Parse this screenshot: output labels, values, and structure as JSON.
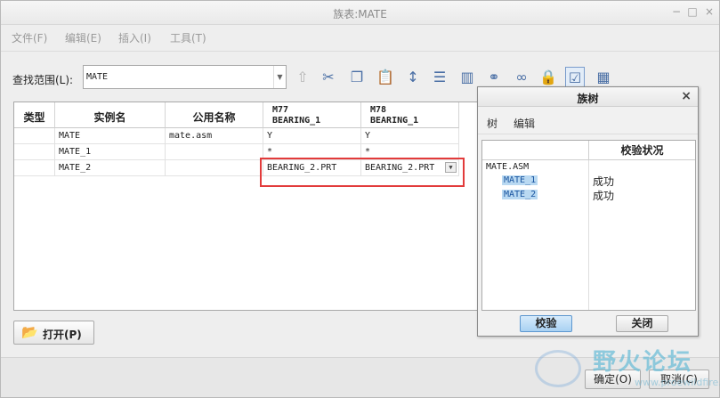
{
  "window": {
    "title": "族表:MATE",
    "minimize": "−",
    "maximize": "□",
    "close": "×"
  },
  "menu": [
    "文件(F)",
    "编辑(E)",
    "插入(I)",
    "工具(T)"
  ],
  "find": {
    "label": "查找范围(L):",
    "value": "MATE"
  },
  "toolbar_icons": [
    "up-level-icon",
    "cut-icon",
    "copy-icon",
    "paste-icon",
    "sort-icon",
    "insert-row-icon",
    "insert-column-icon",
    "binoculars-icon",
    "glasses-icon",
    "lock-icon",
    "verify-instances-icon",
    "table-icon"
  ],
  "table": {
    "headers": {
      "type": "类型",
      "instance": "实例名",
      "common": "公用名称",
      "col1": {
        "line1": "M77",
        "line2": "BEARING_1"
      },
      "col2": {
        "line1": "M78",
        "line2": "BEARING_1"
      }
    },
    "rows": [
      {
        "type": "",
        "instance": "MATE",
        "common": "mate.asm",
        "col1": "Y",
        "col2": "Y"
      },
      {
        "type": "",
        "instance": "MATE_1",
        "common": "",
        "col1": "*",
        "col2": "*"
      },
      {
        "type": "",
        "instance": "MATE_2",
        "common": "",
        "col1": "BEARING_2.PRT",
        "col2": "BEARING_2.PRT"
      }
    ]
  },
  "buttons": {
    "open": "打开(P)",
    "ok": "确定(O)",
    "cancel": "取消(C)"
  },
  "family_tree": {
    "title": "族树",
    "menu": [
      "树",
      "编辑"
    ],
    "column_header": "校验状况",
    "root": "MATE.ASM",
    "items": [
      {
        "name": "MATE_1",
        "status": "成功"
      },
      {
        "name": "MATE_2",
        "status": "成功"
      }
    ],
    "verify_button": "校验",
    "close_button": "关闭"
  },
  "watermark": {
    "text": "野火论坛",
    "url": "www.proewildfire.cn"
  }
}
